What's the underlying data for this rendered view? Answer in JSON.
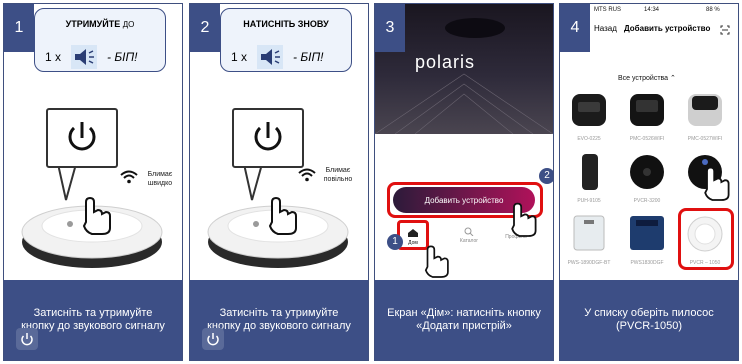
{
  "steps": [
    {
      "number": "1",
      "callout_title": "УТРИМУЙТЕ",
      "callout_title_suffix": "ДО",
      "callout_count": "1 x",
      "callout_beep": "- БІП!",
      "indicator_text": "Блимає швидко",
      "caption": "Затисніть та утримуйте кнопку  до звукового сигналу"
    },
    {
      "number": "2",
      "callout_title": "НАТИСНІТЬ ЗНОВУ",
      "callout_count": "1 x",
      "callout_beep": "- БІП!",
      "indicator_text": "Блимає повільно",
      "caption": "Затисніть та утримуйте кнопку до звукового сигналу"
    },
    {
      "number": "3",
      "brand": "polaris",
      "add_device_button": "Добавить устройство",
      "tabs": [
        "Дом",
        "Каталог",
        "Профиль"
      ],
      "badge_1": "1",
      "badge_2": "2",
      "caption": "Екран «Дім»: натисніть кнопку «Додати пристрій»"
    },
    {
      "number": "4",
      "status_carrier": "MTS RUS",
      "status_time": "14:34",
      "status_battery": "88 %",
      "back": "Назад",
      "title": "Добавить устройство",
      "filter": "Все устройства",
      "devices": [
        "EVO-0225",
        "PMC-0526WIFI",
        "PMC-0527WIFI",
        "PUH-9105",
        "PVCR-3200",
        "",
        "PWS-1890DGF-BT",
        "PWS1830DGF",
        "PVCR – 1050"
      ],
      "caption": "У списку оберіть пилосос (PVCR-1050)"
    }
  ],
  "colors": {
    "caption_bg": "#3d4f86",
    "highlight": "#e01010",
    "button_gradient_end": "#b0125a"
  }
}
